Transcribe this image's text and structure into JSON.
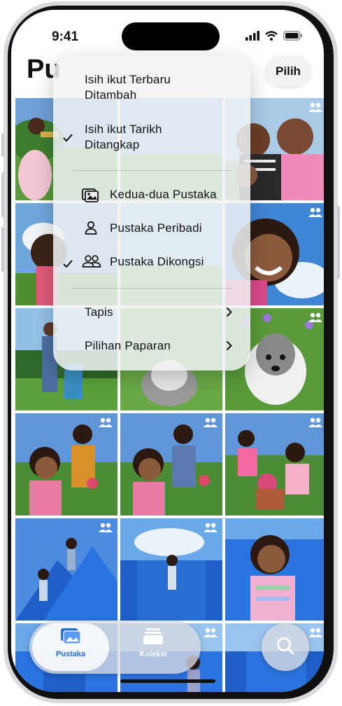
{
  "status_bar": {
    "time": "9:41"
  },
  "header": {
    "title_visible": "Pu",
    "select_button": "Pilih"
  },
  "menu": {
    "sort_items": [
      {
        "label": "Isih ikut Terbaru Ditambah",
        "checked": false
      },
      {
        "label": "Isih ikut Tarikh Ditangkap",
        "checked": true
      }
    ],
    "library_items": [
      {
        "label": "Kedua-dua Pustaka",
        "icon": "photos-stack-icon",
        "checked": false
      },
      {
        "label": "Pustaka Peribadi",
        "icon": "person-icon",
        "checked": false
      },
      {
        "label": "Pustaka Dikongsi",
        "icon": "people-icon",
        "checked": true
      }
    ],
    "sub_items": [
      {
        "label": "Tapis",
        "icon": "chevron-right-icon"
      },
      {
        "label": "Pilihan Paparan",
        "icon": "chevron-right-icon"
      }
    ]
  },
  "tab_bar": {
    "tabs": [
      {
        "label": "Pustaka",
        "icon": "photos-icon",
        "active": true
      },
      {
        "label": "Koleksi",
        "icon": "collections-icon",
        "active": false
      }
    ],
    "search": {
      "icon": "search-icon"
    }
  },
  "grid": {
    "photos": [
      {
        "subject": "girl-playing-trumpet",
        "shared": false
      },
      {
        "subject": "girl-on-grass",
        "shared": false
      },
      {
        "subject": "family-selfie",
        "shared": true
      },
      {
        "subject": "girl-looking-up",
        "shared": false
      },
      {
        "subject": "",
        "shared": false
      },
      {
        "subject": "smiling-girl-closeup",
        "shared": true
      },
      {
        "subject": "man-and-child-walking",
        "shared": false
      },
      {
        "subject": "dog-on-grass",
        "shared": false
      },
      {
        "subject": "fluffy-dog-flowers",
        "shared": true
      },
      {
        "subject": "kids-with-flowers-1",
        "shared": true
      },
      {
        "subject": "kids-with-flowers-2",
        "shared": true
      },
      {
        "subject": "kids-with-flowers-3",
        "shared": true
      },
      {
        "subject": "bouncy-castle-1",
        "shared": false
      },
      {
        "subject": "bouncy-castle-2",
        "shared": true
      },
      {
        "subject": "bouncy-castle-girl",
        "shared": false
      },
      {
        "subject": "bouncy-castle-4",
        "shared": false
      },
      {
        "subject": "bouncy-castle-5",
        "shared": true
      },
      {
        "subject": "bouncy-castle-6",
        "shared": true
      }
    ]
  }
}
